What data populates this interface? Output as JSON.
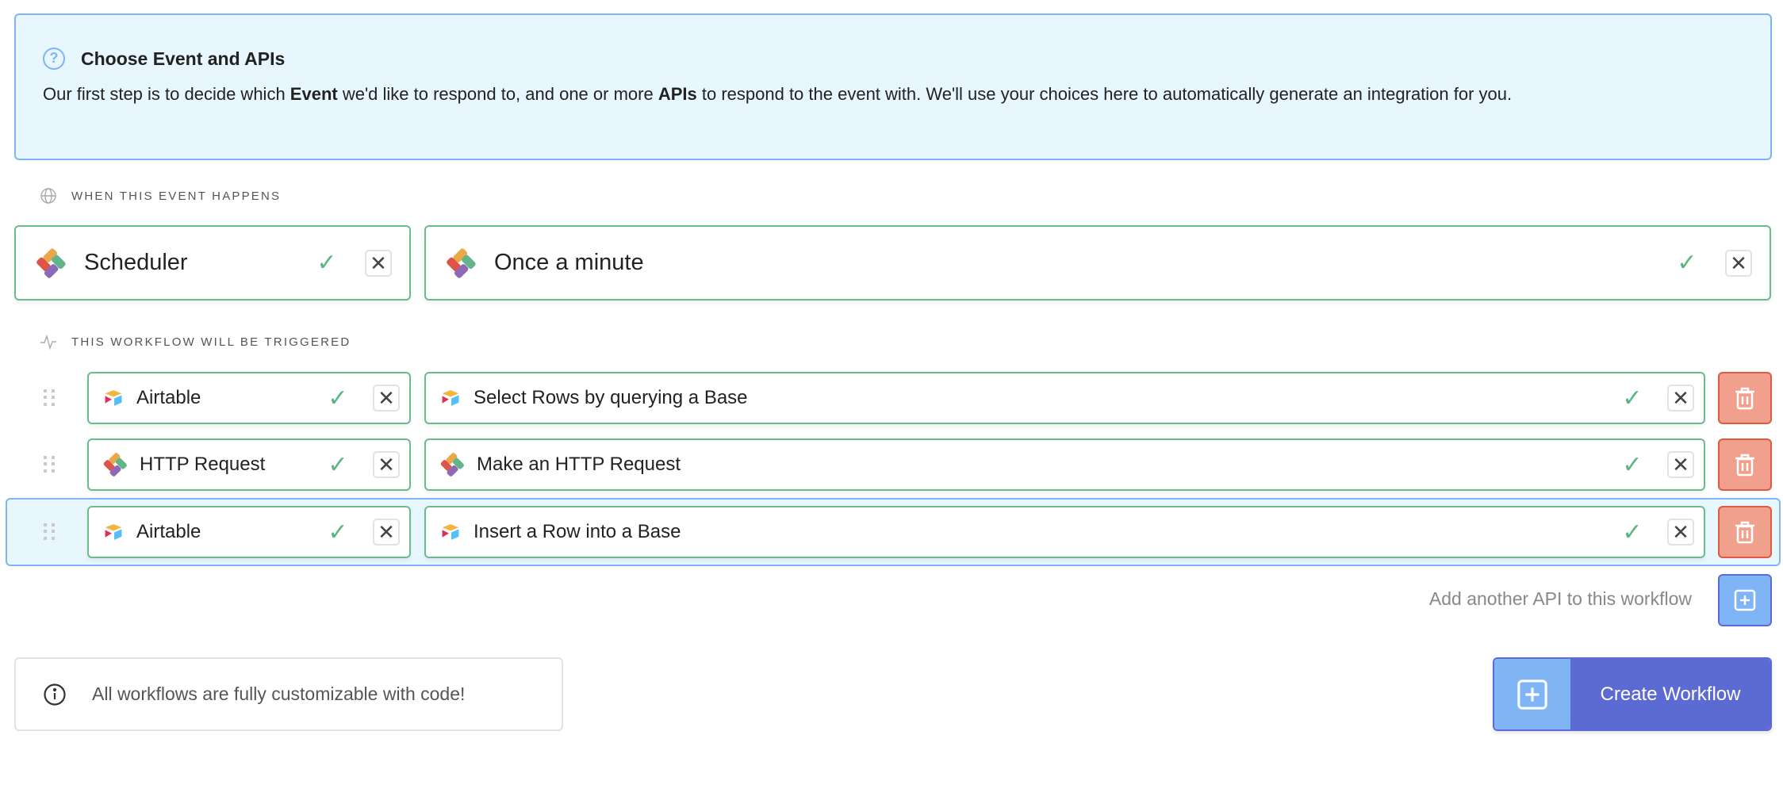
{
  "intro": {
    "title": "Choose Event and APIs",
    "body_parts": [
      "Our first step is to decide which ",
      "Event",
      " we'd like to respond to, and one or more ",
      "APIs",
      " to respond to the event with. We'll use your choices here to automatically generate an integration for you."
    ]
  },
  "event_section": {
    "label": "WHEN THIS EVENT HAPPENS",
    "app": "Scheduler",
    "trigger": "Once a minute"
  },
  "workflow_section": {
    "label": "THIS WORKFLOW WILL BE TRIGGERED",
    "steps": [
      {
        "app": "Airtable",
        "action": "Select Rows by querying a Base",
        "app_icon": "airtable-logo"
      },
      {
        "app": "HTTP Request",
        "action": "Make an HTTP Request",
        "app_icon": "pipedream-logo"
      },
      {
        "app": "Airtable",
        "action": "Insert a Row into a Base",
        "app_icon": "airtable-logo"
      }
    ],
    "add_label": "Add another API to this workflow"
  },
  "footer": {
    "note": "All workflows are fully customizable with code!",
    "create_label": "Create Workflow"
  },
  "colors": {
    "accent": "#5c6bd4",
    "success": "#5cb581",
    "danger": "#f0a08c",
    "info_bg": "#e8f6fe"
  }
}
